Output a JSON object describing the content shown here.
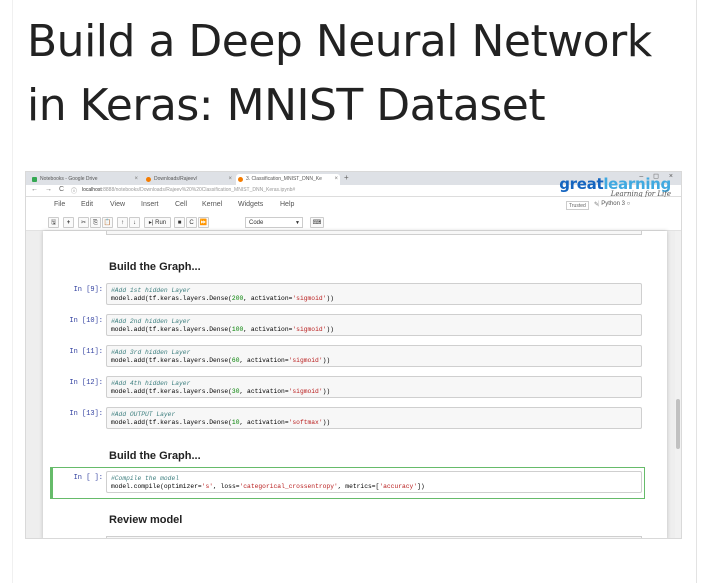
{
  "page": {
    "title": "Build a Deep Neural Network in Keras: MNIST Dataset"
  },
  "browser": {
    "tabs": [
      {
        "label": "Notebooks - Google Drive",
        "close": "×"
      },
      {
        "label": "Downloads/Rajeev/",
        "close": "×"
      },
      {
        "label": "3. Classification_MNIST_DNN_Ke",
        "close": "×"
      }
    ],
    "new_tab": "+",
    "window_controls": "– ◻ ×",
    "back": "←",
    "forward": "→",
    "reload": "C",
    "url_host": "localhost",
    "url_path": ":8888/notebooks/Downloads/Rajeev%20%20Classification_MNIST_DNN_Keras.ipynb#"
  },
  "brand": {
    "logo_a": "great",
    "logo_b": "learning",
    "tagline": "Learning for Life"
  },
  "jupyter": {
    "menus": [
      "File",
      "Edit",
      "View",
      "Insert",
      "Cell",
      "Kernel",
      "Widgets",
      "Help"
    ],
    "trusted": "Trusted",
    "kernel": "Python 3",
    "toolbar": {
      "save": "🖫",
      "add": "+",
      "cut": "✂",
      "copy": "⎘",
      "paste": "📋",
      "up": "↑",
      "down": "↓",
      "run": "▸| Run",
      "stop": "■",
      "restart": "C",
      "fastforward": "⏩",
      "celltype": "Code",
      "keyboard": "⌨"
    }
  },
  "notebook": {
    "heading1": "Build the Graph...",
    "heading2": "Build the Graph...",
    "heading3": "Review model",
    "cells": [
      {
        "prompt": "In [9]:",
        "comment": "#Add 1st hidden Layer",
        "code_a": "model.add(tf.keras.layers.Dense(",
        "num": "200",
        "code_b": ", activation=",
        "str": "'sigmoid'",
        "code_c": "))"
      },
      {
        "prompt": "In [10]:",
        "comment": "#Add 2nd hidden Layer",
        "code_a": "model.add(tf.keras.layers.Dense(",
        "num": "100",
        "code_b": ", activation=",
        "str": "'sigmoid'",
        "code_c": "))"
      },
      {
        "prompt": "In [11]:",
        "comment": "#Add 3rd hidden Layer",
        "code_a": "model.add(tf.keras.layers.Dense(",
        "num": "60",
        "code_b": ", activation=",
        "str": "'sigmoid'",
        "code_c": "))"
      },
      {
        "prompt": "In [12]:",
        "comment": "#Add 4th hidden Layer",
        "code_a": "model.add(tf.keras.layers.Dense(",
        "num": "30",
        "code_b": ", activation=",
        "str": "'sigmoid'",
        "code_c": "))"
      },
      {
        "prompt": "In [13]:",
        "comment": "#Add OUTPUT Layer",
        "code_a": "model.add(tf.keras.layers.Dense(",
        "num": "10",
        "code_b": ", activation=",
        "str": "'softmax'",
        "code_c": "))"
      }
    ],
    "compile_cell": {
      "prompt": "In [ ]:",
      "comment": "#Compile the model",
      "code_a": "model.compile(optimizer=",
      "str_a": "'s'",
      "code_b": ", loss=",
      "str_b": "'categorical_crossentropy'",
      "code_c": ", metrics=[",
      "str_c": "'accuracy'",
      "code_d": "])"
    }
  }
}
